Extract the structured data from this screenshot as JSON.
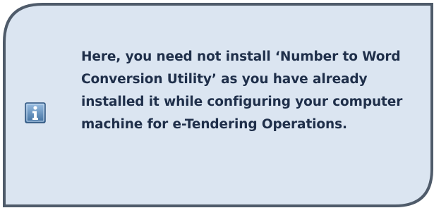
{
  "note": {
    "text": "Here, you need not install ‘Number to Word Conversion Utility’ as you have already installed it while configuring your computer machine for e-Tendering Operations.",
    "icon": "info-icon",
    "colors": {
      "fill": "#dbe5f1",
      "border": "#4f5b6a",
      "text": "#1f2f4a",
      "icon_top": "#8fb3d9",
      "icon_bottom": "#3f6f9f"
    }
  }
}
